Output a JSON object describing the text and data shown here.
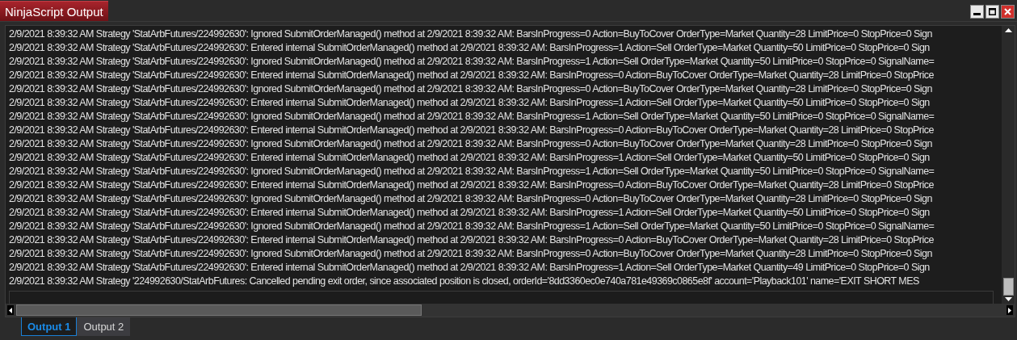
{
  "window": {
    "title": "NinjaScript Output"
  },
  "lines": [
    "2/9/2021 8:39:32 AM Strategy 'StatArbFutures/224992630': Ignored SubmitOrderManaged() method at 2/9/2021 8:39:32 AM: BarsInProgress=0 Action=BuyToCover OrderType=Market Quantity=28 LimitPrice=0 StopPrice=0 Sign",
    "2/9/2021 8:39:32 AM Strategy 'StatArbFutures/224992630': Entered internal SubmitOrderManaged() method at 2/9/2021 8:39:32 AM: BarsInProgress=1 Action=Sell OrderType=Market Quantity=50 LimitPrice=0 StopPrice=0 Sign",
    "2/9/2021 8:39:32 AM Strategy 'StatArbFutures/224992630': Ignored SubmitOrderManaged() method at 2/9/2021 8:39:32 AM: BarsInProgress=1 Action=Sell OrderType=Market Quantity=50 LimitPrice=0 StopPrice=0 SignalName=",
    "2/9/2021 8:39:32 AM Strategy 'StatArbFutures/224992630': Entered internal SubmitOrderManaged() method at 2/9/2021 8:39:32 AM: BarsInProgress=0 Action=BuyToCover OrderType=Market Quantity=28 LimitPrice=0 StopPrice",
    "2/9/2021 8:39:32 AM Strategy 'StatArbFutures/224992630': Ignored SubmitOrderManaged() method at 2/9/2021 8:39:32 AM: BarsInProgress=0 Action=BuyToCover OrderType=Market Quantity=28 LimitPrice=0 StopPrice=0 Sign",
    "2/9/2021 8:39:32 AM Strategy 'StatArbFutures/224992630': Entered internal SubmitOrderManaged() method at 2/9/2021 8:39:32 AM: BarsInProgress=1 Action=Sell OrderType=Market Quantity=50 LimitPrice=0 StopPrice=0 Sign",
    "2/9/2021 8:39:32 AM Strategy 'StatArbFutures/224992630': Ignored SubmitOrderManaged() method at 2/9/2021 8:39:32 AM: BarsInProgress=1 Action=Sell OrderType=Market Quantity=50 LimitPrice=0 StopPrice=0 SignalName=",
    "2/9/2021 8:39:32 AM Strategy 'StatArbFutures/224992630': Entered internal SubmitOrderManaged() method at 2/9/2021 8:39:32 AM: BarsInProgress=0 Action=BuyToCover OrderType=Market Quantity=28 LimitPrice=0 StopPrice",
    "2/9/2021 8:39:32 AM Strategy 'StatArbFutures/224992630': Ignored SubmitOrderManaged() method at 2/9/2021 8:39:32 AM: BarsInProgress=0 Action=BuyToCover OrderType=Market Quantity=28 LimitPrice=0 StopPrice=0 Sign",
    "2/9/2021 8:39:32 AM Strategy 'StatArbFutures/224992630': Entered internal SubmitOrderManaged() method at 2/9/2021 8:39:32 AM: BarsInProgress=1 Action=Sell OrderType=Market Quantity=50 LimitPrice=0 StopPrice=0 Sign",
    "2/9/2021 8:39:32 AM Strategy 'StatArbFutures/224992630': Ignored SubmitOrderManaged() method at 2/9/2021 8:39:32 AM: BarsInProgress=1 Action=Sell OrderType=Market Quantity=50 LimitPrice=0 StopPrice=0 SignalName=",
    "2/9/2021 8:39:32 AM Strategy 'StatArbFutures/224992630': Entered internal SubmitOrderManaged() method at 2/9/2021 8:39:32 AM: BarsInProgress=0 Action=BuyToCover OrderType=Market Quantity=28 LimitPrice=0 StopPrice",
    "2/9/2021 8:39:32 AM Strategy 'StatArbFutures/224992630': Ignored SubmitOrderManaged() method at 2/9/2021 8:39:32 AM: BarsInProgress=0 Action=BuyToCover OrderType=Market Quantity=28 LimitPrice=0 StopPrice=0 Sign",
    "2/9/2021 8:39:32 AM Strategy 'StatArbFutures/224992630': Entered internal SubmitOrderManaged() method at 2/9/2021 8:39:32 AM: BarsInProgress=1 Action=Sell OrderType=Market Quantity=50 LimitPrice=0 StopPrice=0 Sign",
    "2/9/2021 8:39:32 AM Strategy 'StatArbFutures/224992630': Ignored SubmitOrderManaged() method at 2/9/2021 8:39:32 AM: BarsInProgress=1 Action=Sell OrderType=Market Quantity=50 LimitPrice=0 StopPrice=0 SignalName=",
    "2/9/2021 8:39:32 AM Strategy 'StatArbFutures/224992630': Entered internal SubmitOrderManaged() method at 2/9/2021 8:39:32 AM: BarsInProgress=0 Action=BuyToCover OrderType=Market Quantity=28 LimitPrice=0 StopPrice",
    "2/9/2021 8:39:32 AM Strategy 'StatArbFutures/224992630': Ignored SubmitOrderManaged() method at 2/9/2021 8:39:32 AM: BarsInProgress=0 Action=BuyToCover OrderType=Market Quantity=28 LimitPrice=0 StopPrice=0 Sign",
    "2/9/2021 8:39:32 AM Strategy 'StatArbFutures/224992630': Entered internal SubmitOrderManaged() method at 2/9/2021 8:39:32 AM: BarsInProgress=1 Action=Sell OrderType=Market Quantity=49 LimitPrice=0 StopPrice=0 Sign",
    "2/9/2021 8:39:32 AM Strategy '224992630/StatArbFutures: Cancelled pending exit order, since associated position is closed, orderId='8dd3360ec0e740a781e49369c0865e8f' account='Playback101' name='EXIT SHORT MES"
  ],
  "tabs": [
    {
      "label": "Output 1",
      "selected": true
    },
    {
      "label": "Output 2",
      "selected": false
    }
  ]
}
